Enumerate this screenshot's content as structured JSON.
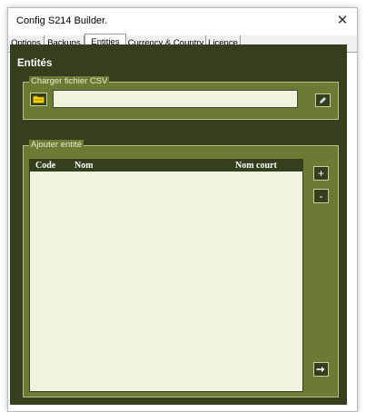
{
  "window": {
    "title": "Config S214 Builder.",
    "close_glyph": "✕"
  },
  "tabs": [
    {
      "label": "Options"
    },
    {
      "label": "Backups"
    },
    {
      "label": "Entities"
    },
    {
      "label": "Currency & Country"
    },
    {
      "label": "Licence"
    }
  ],
  "active_tab": "Entities",
  "page": {
    "title": "Entités"
  },
  "load_csv": {
    "label": "Charger fichier CSV",
    "path_value": "",
    "folder_icon": "folder-icon",
    "pencil_icon": "pencil-icon"
  },
  "add_entity": {
    "label": "Ajouter entité",
    "columns": [
      "Code",
      "Nom",
      "Nom court"
    ],
    "rows": [],
    "add_glyph": "+",
    "remove_glyph": "-",
    "submit_icon": "arrow-right-icon"
  },
  "colors": {
    "panel_bg": "#333f1d",
    "group_bg": "#6a7b34",
    "input_bg": "#f2f3dc",
    "folder_icon": "#f5d400"
  }
}
